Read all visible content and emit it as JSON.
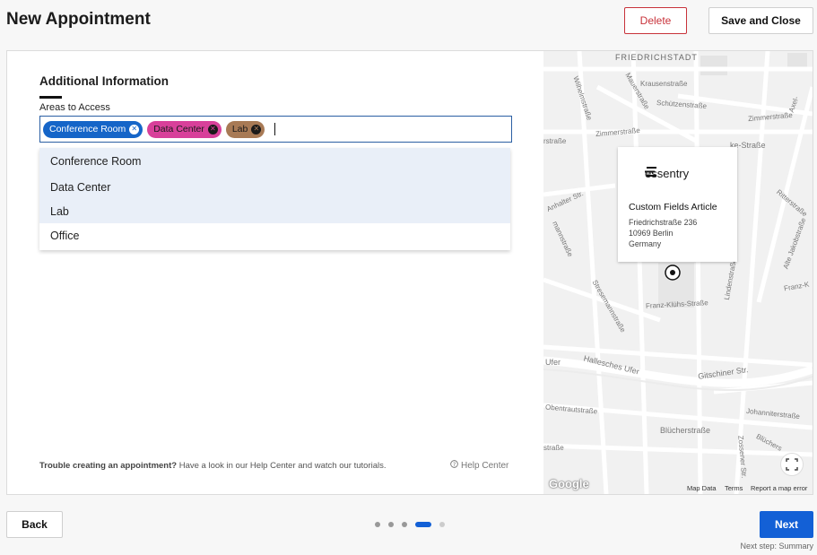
{
  "header": {
    "title": "New Appointment",
    "delete_label": "Delete",
    "save_close_label": "Save and Close"
  },
  "form": {
    "section_title": "Additional Information",
    "areas_label": "Areas to Access",
    "selected_tags": [
      {
        "label": "Conference Room",
        "color": "#1565c8"
      },
      {
        "label": "Data Center",
        "color": "#d8409a"
      },
      {
        "label": "Lab",
        "color": "#a87a55"
      }
    ],
    "options": [
      {
        "label": "Conference Room",
        "selected": true
      },
      {
        "label": "Data Center",
        "selected": true
      },
      {
        "label": "Lab",
        "selected": true
      },
      {
        "label": "Office",
        "selected": false
      }
    ],
    "help_bold": "Trouble creating an appointment?",
    "help_text": " Have a look in our Help Center and watch our tutorials.",
    "help_link": "Help Center"
  },
  "map": {
    "brand": "essentry",
    "place_title": "Custom Fields Article",
    "address_line1": "Friedrichstraße 236",
    "address_line2": "10969 Berlin",
    "address_line3": "Germany",
    "district_label": "FRIEDRICHSTADT",
    "streets": {
      "krausen": "Krausenstraße",
      "schuetzen": "Schützenstraße",
      "zimmer1": "Zimmerstraße",
      "zimmer2": "Zimmerstraße",
      "wilhelm": "Wilhelmstraße",
      "mauer": "Mauerstraße",
      "anhalter": "Anhalter Str.",
      "linden": "Lindenstraße",
      "ritter": "Ritterstraße",
      "alte_jakob": "Alte Jakobstraße",
      "franz_kluehs": "Franz-Klühs-Straße",
      "stresemann": "Stresemannstraße",
      "halle": "Hallesches Ufer",
      "gitschiner": "Gitschiner Str.",
      "johanniter": "Johanniterstraße",
      "obentraut": "Obentrautstraße",
      "bluecher": "Blücherstraße",
      "zossener": "Zossener Str.",
      "ufer": "Ufer",
      "kochstr": "ke-Straße",
      "franzk2": "Franz-K",
      "axel": "Axel-",
      "strasse1": "rstraße",
      "strasse2": "straße",
      "mannstr": "mannstraße",
      "bluech2": "Blüchers"
    },
    "google": "Google",
    "attribution_data": "Map Data",
    "attribution_terms": "Terms",
    "attribution_report": "Report a map error"
  },
  "footer": {
    "back_label": "Back",
    "next_label": "Next",
    "next_step": "Next step: Summary",
    "steps_total": 5,
    "current_step": 4
  }
}
